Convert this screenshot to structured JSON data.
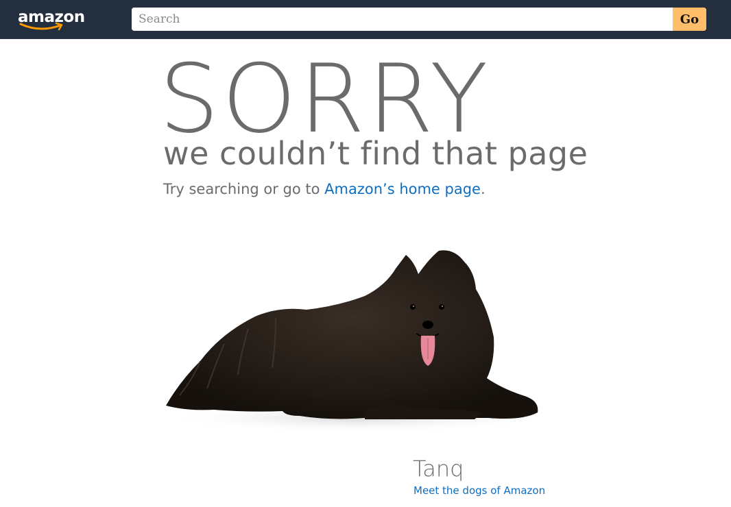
{
  "header": {
    "logo_text": "amazon",
    "search": {
      "placeholder": "Search",
      "value": ""
    },
    "go_label": "Go"
  },
  "error": {
    "title": "SORRY",
    "subtitle": "we couldn’t find that page",
    "try_prefix": "Try searching or go to ",
    "home_link": "Amazon’s home page",
    "try_suffix": "."
  },
  "dog": {
    "name": "Tanq",
    "link": "Meet the dogs of Amazon"
  },
  "colors": {
    "header_bg": "#232f3e",
    "go_button": "#febd69",
    "link": "#0d6ec2",
    "text_gray": "#6b6b6b"
  },
  "icons": [
    "amazon-logo-smile",
    "dog-photo"
  ]
}
